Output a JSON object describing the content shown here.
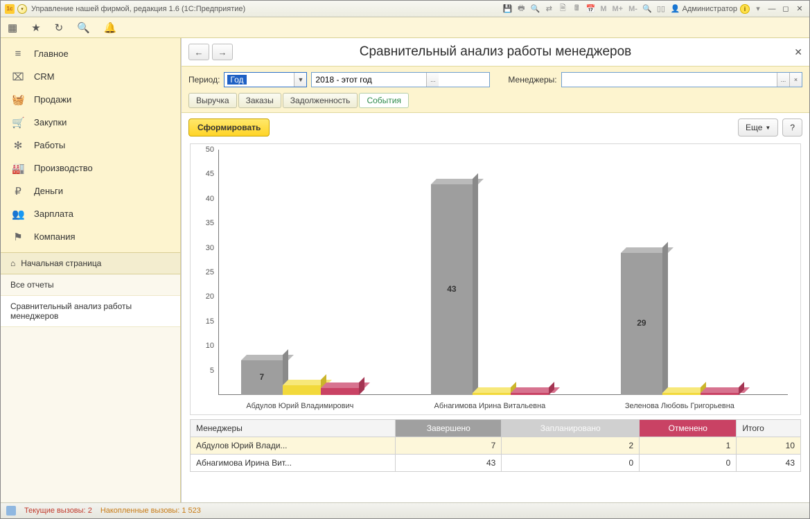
{
  "titlebar": {
    "app_title": "Управление нашей фирмой, редакция 1.6  (1С:Предприятие)",
    "user": "Администратор",
    "m_labels": [
      "M",
      "M+",
      "M-"
    ]
  },
  "sidebar": {
    "items": [
      {
        "icon": "≡",
        "label": "Главное"
      },
      {
        "icon": "⌧",
        "label": "CRM"
      },
      {
        "icon": "🧺",
        "label": "Продажи"
      },
      {
        "icon": "🛒",
        "label": "Закупки"
      },
      {
        "icon": "✻",
        "label": "Работы"
      },
      {
        "icon": "🏭",
        "label": "Производство"
      },
      {
        "icon": "₽",
        "label": "Деньги"
      },
      {
        "icon": "👥",
        "label": "Зарплата"
      },
      {
        "icon": "⚑",
        "label": "Компания"
      }
    ],
    "home": "Начальная страница",
    "subs": [
      "Все отчеты",
      "Сравнительный анализ работы менеджеров"
    ]
  },
  "content": {
    "title": "Сравнительный анализ работы менеджеров",
    "period_label": "Период:",
    "period_value": "Год",
    "period_range": "2018 - этот год",
    "managers_label": "Менеджеры:",
    "managers_value": "",
    "tabs": [
      "Выручка",
      "Заказы",
      "Задолженность",
      "События"
    ],
    "active_tab": 3,
    "btn_form": "Сформировать",
    "btn_more": "Еще",
    "btn_help": "?"
  },
  "chart_data": {
    "type": "bar",
    "ylim": [
      0,
      50
    ],
    "yticks": [
      5,
      10,
      15,
      20,
      25,
      30,
      35,
      40,
      45,
      50
    ],
    "categories": [
      "Абдулов Юрий Владимирович",
      "Абнагимова Ирина Витальевна",
      "Зеленова Любовь Григорьевна"
    ],
    "series": [
      {
        "name": "Завершено",
        "color": "#9e9e9e",
        "values": [
          7,
          43,
          29
        ]
      },
      {
        "name": "Запланировано",
        "color": "#f2d93b",
        "values": [
          2,
          0,
          0
        ]
      },
      {
        "name": "Отменено",
        "color": "#c94264",
        "values": [
          1,
          0,
          0
        ]
      }
    ],
    "bar_value_labels": [
      7,
      43,
      29
    ]
  },
  "table": {
    "headers": [
      "Менеджеры",
      "Завершено",
      "Запланировано",
      "Отменено",
      "Итого"
    ],
    "rows": [
      {
        "name": "Абдулов Юрий Влади...",
        "done": 7,
        "plan": 2,
        "cancel": 1,
        "total": 10,
        "selected": true
      },
      {
        "name": "Абнагимова Ирина Вит...",
        "done": 43,
        "plan": 0,
        "cancel": 0,
        "total": 43,
        "selected": false
      }
    ]
  },
  "statusbar": {
    "current_label": "Текущие вызовы:",
    "current_value": "2",
    "accum_label": "Накопленные вызовы:",
    "accum_value": "1 523"
  }
}
